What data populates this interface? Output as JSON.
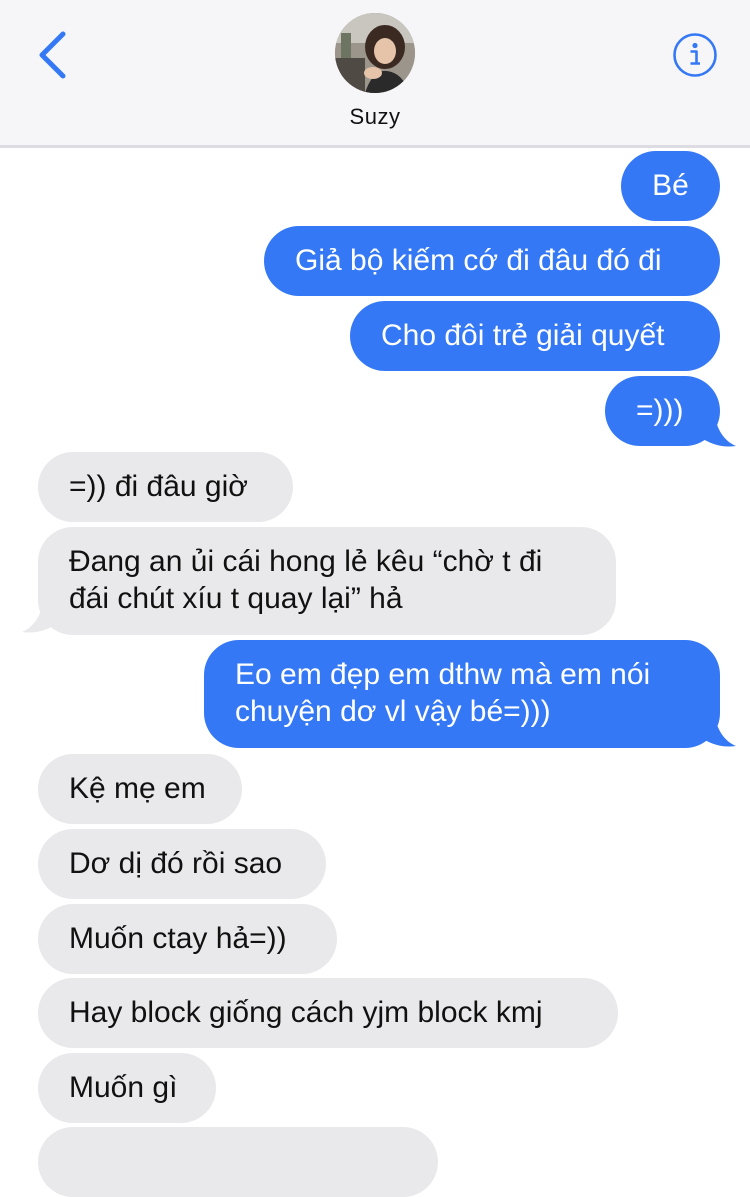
{
  "header": {
    "contact_name": "Suzy",
    "back_icon": "chevron-left-icon",
    "info_icon": "info-icon",
    "accent_color": "#3478f6"
  },
  "colors": {
    "sent_bubble": "#3478f6",
    "received_bubble": "#e9e9eb",
    "sent_text": "#ffffff",
    "received_text": "#111111"
  },
  "messages": [
    {
      "direction": "sent",
      "text": "Bé"
    },
    {
      "direction": "sent",
      "text": "Giả bộ kiếm cớ đi đâu đó đi"
    },
    {
      "direction": "sent",
      "text": "Cho đôi trẻ giải quyết"
    },
    {
      "direction": "sent",
      "text": "=)))"
    },
    {
      "direction": "received",
      "text": "=)) đi đâu giờ"
    },
    {
      "direction": "received",
      "text": "Đang an ủi cái hong lẻ kêu “chờ t đi\nđái chút xíu t quay lại” hả"
    },
    {
      "direction": "sent",
      "text": "Eo em đẹp em dthw mà em nói\nchuyện dơ vl vậy bé=)))"
    },
    {
      "direction": "received",
      "text": "Kệ mẹ em"
    },
    {
      "direction": "received",
      "text": "Dơ dị đó rồi sao"
    },
    {
      "direction": "received",
      "text": "Muốn ctay hả=))"
    },
    {
      "direction": "received",
      "text": "Hay block giống cách yjm block kmj"
    },
    {
      "direction": "received",
      "text": "Muốn gì"
    }
  ]
}
